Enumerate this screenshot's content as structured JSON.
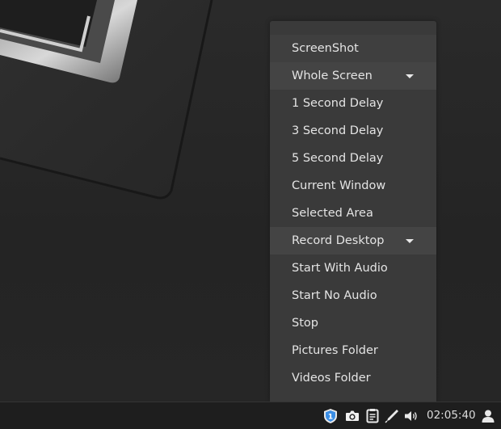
{
  "menu": {
    "items": [
      {
        "label": "ScreenShot",
        "kind": "header"
      },
      {
        "label": "Whole Screen",
        "kind": "section",
        "expanded": true
      },
      {
        "label": "1 Second Delay",
        "kind": "item"
      },
      {
        "label": "3 Second Delay",
        "kind": "item"
      },
      {
        "label": "5 Second Delay",
        "kind": "item"
      },
      {
        "label": "Current Window",
        "kind": "item"
      },
      {
        "label": "Selected Area",
        "kind": "item"
      },
      {
        "label": "Record Desktop",
        "kind": "section",
        "expanded": true
      },
      {
        "label": "Start With Audio",
        "kind": "item"
      },
      {
        "label": "Start No Audio",
        "kind": "item"
      },
      {
        "label": "Stop",
        "kind": "item"
      },
      {
        "label": "Pictures Folder",
        "kind": "item"
      },
      {
        "label": "Videos Folder",
        "kind": "item"
      }
    ]
  },
  "taskbar": {
    "tray_icons": [
      "shield-update-icon",
      "camera-icon",
      "clipboard-icon",
      "pen-icon",
      "volume-icon",
      "user-icon"
    ],
    "clock": "02:05:40"
  },
  "colors": {
    "menu_bg": "#3a3a3a",
    "section_bg": "#444444",
    "taskbar_bg": "#1e1e1e",
    "shield_blue": "#3a8ee6"
  }
}
